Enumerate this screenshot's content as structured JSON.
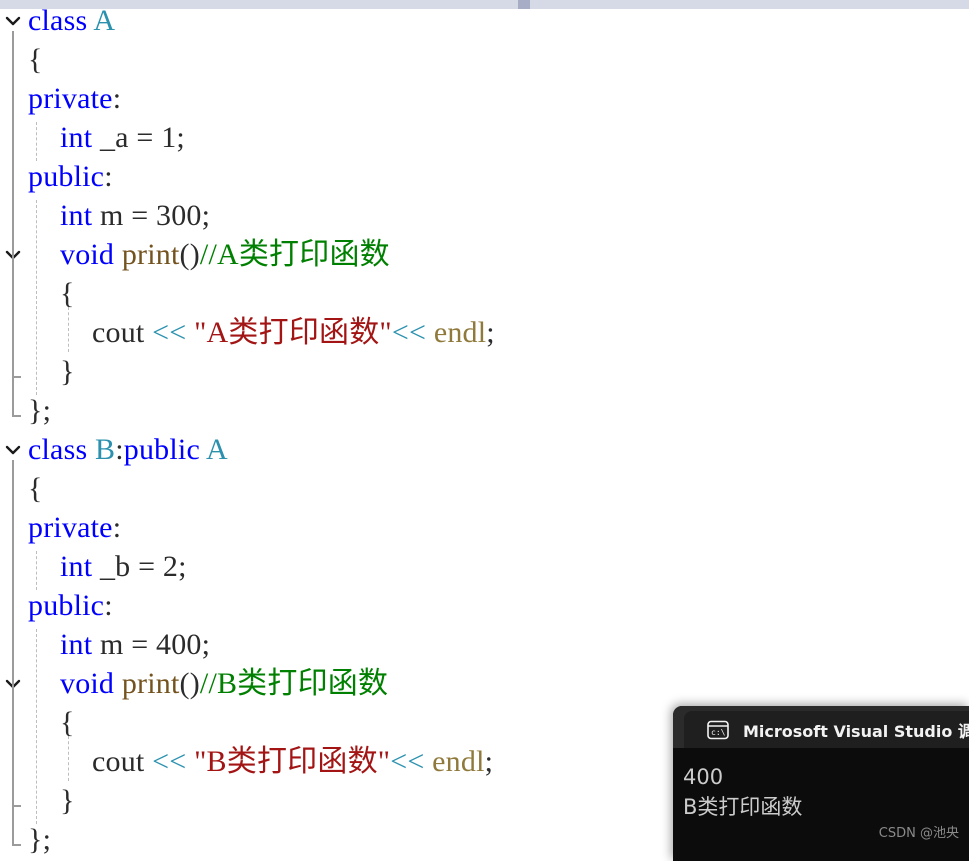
{
  "editor": {
    "language": "cpp",
    "colors": {
      "keyword": "#0000ff",
      "type": "#2b91af",
      "function": "#74531f",
      "comment": "#008000",
      "string": "#a31515",
      "operator": "#2b91af",
      "macro": "#8f7a3c",
      "plain": "#2b2b2b",
      "background": "#ffffff",
      "gutter_line": "#9b9b9b",
      "indent_guide": "#bdbdbd"
    },
    "lines": [
      {
        "indent": 0,
        "collapsible": true,
        "tokens": [
          {
            "t": "class ",
            "c": "kw"
          },
          {
            "t": "A",
            "c": "type"
          }
        ]
      },
      {
        "indent": 0,
        "collapsible": false,
        "tokens": [
          {
            "t": "{",
            "c": "pln"
          }
        ]
      },
      {
        "indent": 0,
        "collapsible": false,
        "tokens": [
          {
            "t": "private",
            "c": "kw"
          },
          {
            "t": ":",
            "c": "pln"
          }
        ]
      },
      {
        "indent": 1,
        "collapsible": false,
        "tokens": [
          {
            "t": "int",
            "c": "kw"
          },
          {
            "t": " _a = 1;",
            "c": "pln"
          }
        ]
      },
      {
        "indent": 0,
        "collapsible": false,
        "tokens": [
          {
            "t": "public",
            "c": "kw"
          },
          {
            "t": ":",
            "c": "pln"
          }
        ]
      },
      {
        "indent": 1,
        "collapsible": false,
        "tokens": [
          {
            "t": "int",
            "c": "kw"
          },
          {
            "t": " m = 300;",
            "c": "pln"
          }
        ]
      },
      {
        "indent": 1,
        "collapsible": true,
        "tokens": [
          {
            "t": "void ",
            "c": "kw"
          },
          {
            "t": "print",
            "c": "fn"
          },
          {
            "t": "()",
            "c": "pln"
          },
          {
            "t": "//A类打印函数",
            "c": "cmt"
          }
        ]
      },
      {
        "indent": 1,
        "collapsible": false,
        "tokens": [
          {
            "t": "{",
            "c": "pln"
          }
        ]
      },
      {
        "indent": 2,
        "collapsible": false,
        "tokens": [
          {
            "t": "cout ",
            "c": "pln"
          },
          {
            "t": "<<",
            "c": "op"
          },
          {
            "t": " ",
            "c": "pln"
          },
          {
            "t": "\"A类打印函数\"",
            "c": "str"
          },
          {
            "t": "<<",
            "c": "op"
          },
          {
            "t": " ",
            "c": "pln"
          },
          {
            "t": "endl",
            "c": "mac"
          },
          {
            "t": ";",
            "c": "pln"
          }
        ]
      },
      {
        "indent": 1,
        "collapsible": false,
        "tokens": [
          {
            "t": "}",
            "c": "pln"
          }
        ]
      },
      {
        "indent": 0,
        "collapsible": false,
        "tokens": [
          {
            "t": "};",
            "c": "pln"
          }
        ]
      },
      {
        "indent": 0,
        "collapsible": true,
        "tokens": [
          {
            "t": "class ",
            "c": "kw"
          },
          {
            "t": "B",
            "c": "type"
          },
          {
            "t": ":",
            "c": "pln"
          },
          {
            "t": "public ",
            "c": "kw"
          },
          {
            "t": "A",
            "c": "type"
          }
        ]
      },
      {
        "indent": 0,
        "collapsible": false,
        "tokens": [
          {
            "t": "{",
            "c": "pln"
          }
        ]
      },
      {
        "indent": 0,
        "collapsible": false,
        "tokens": [
          {
            "t": "private",
            "c": "kw"
          },
          {
            "t": ":",
            "c": "pln"
          }
        ]
      },
      {
        "indent": 1,
        "collapsible": false,
        "tokens": [
          {
            "t": "int",
            "c": "kw"
          },
          {
            "t": " _b = 2;",
            "c": "pln"
          }
        ]
      },
      {
        "indent": 0,
        "collapsible": false,
        "tokens": [
          {
            "t": "public",
            "c": "kw"
          },
          {
            "t": ":",
            "c": "pln"
          }
        ]
      },
      {
        "indent": 1,
        "collapsible": false,
        "tokens": [
          {
            "t": "int",
            "c": "kw"
          },
          {
            "t": " m = 400;",
            "c": "pln"
          }
        ]
      },
      {
        "indent": 1,
        "collapsible": true,
        "tokens": [
          {
            "t": "void ",
            "c": "kw"
          },
          {
            "t": "print",
            "c": "fn"
          },
          {
            "t": "()",
            "c": "pln"
          },
          {
            "t": "//B类打印函数",
            "c": "cmt"
          }
        ]
      },
      {
        "indent": 1,
        "collapsible": false,
        "tokens": [
          {
            "t": "{",
            "c": "pln"
          }
        ]
      },
      {
        "indent": 2,
        "collapsible": false,
        "tokens": [
          {
            "t": "cout ",
            "c": "pln"
          },
          {
            "t": "<<",
            "c": "op"
          },
          {
            "t": " ",
            "c": "pln"
          },
          {
            "t": "\"B类打印函数\"",
            "c": "str"
          },
          {
            "t": "<<",
            "c": "op"
          },
          {
            "t": " ",
            "c": "pln"
          },
          {
            "t": "endl",
            "c": "mac"
          },
          {
            "t": ";",
            "c": "pln"
          }
        ]
      },
      {
        "indent": 1,
        "collapsible": false,
        "tokens": [
          {
            "t": "}",
            "c": "pln"
          }
        ]
      },
      {
        "indent": 0,
        "collapsible": false,
        "tokens": [
          {
            "t": "};",
            "c": "pln"
          }
        ]
      }
    ]
  },
  "scrollbar": {
    "orientation": "horizontal",
    "track_color": "#d6d9e6",
    "thumb_color": "#a7adc4"
  },
  "console": {
    "icon": "console-cmd-icon",
    "title": "Microsoft Visual Studio 调试",
    "output_lines": [
      "400",
      "B类打印函数"
    ],
    "background": "#0c0c0c",
    "tab_background": "#2b2b2b",
    "text_color": "#cccccc"
  },
  "watermark": {
    "text": "CSDN @池央"
  }
}
